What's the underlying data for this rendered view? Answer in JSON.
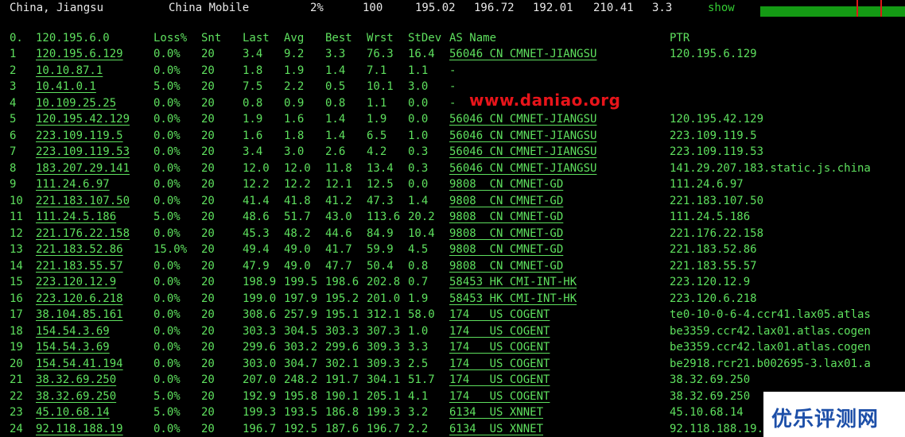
{
  "header": {
    "location": "China, Jiangsu",
    "isp": "China Mobile",
    "loss": "2%",
    "sent": "100",
    "last": "195.02",
    "avg": "196.72",
    "best": "192.01",
    "worst": "210.41",
    "stdev": "3.3",
    "show_link": "show",
    "bar_color": "#149a14",
    "marker_color": "#e01818"
  },
  "table": {
    "columns": {
      "idx": "0.",
      "host": "120.195.6.0",
      "loss": "Loss%",
      "snt": "Snt",
      "last": "Last",
      "avg": "Avg",
      "best": "Best",
      "wrst": "Wrst",
      "stdev": "StDev",
      "as": "AS Name",
      "ptr": "PTR"
    },
    "rows": [
      {
        "idx": "1",
        "host": "120.195.6.129",
        "loss": "0.0%",
        "snt": "20",
        "last": "3.4",
        "avg": "9.2",
        "best": "3.3",
        "wrst": "76.3",
        "stdev": "16.4",
        "as": "56046 CN CMNET-JIANGSU",
        "ptr": "120.195.6.129"
      },
      {
        "idx": "2",
        "host": "10.10.87.1",
        "loss": "0.0%",
        "snt": "20",
        "last": "1.8",
        "avg": "1.9",
        "best": "1.4",
        "wrst": "7.1",
        "stdev": "1.1",
        "as": "-",
        "ptr": ""
      },
      {
        "idx": "3",
        "host": "10.41.0.1",
        "loss": "5.0%",
        "snt": "20",
        "last": "7.5",
        "avg": "2.2",
        "best": "0.5",
        "wrst": "10.1",
        "stdev": "3.0",
        "as": "-",
        "ptr": ""
      },
      {
        "idx": "4",
        "host": "10.109.25.25",
        "loss": "0.0%",
        "snt": "20",
        "last": "0.8",
        "avg": "0.9",
        "best": "0.8",
        "wrst": "1.1",
        "stdev": "0.0",
        "as": "-",
        "ptr": ""
      },
      {
        "idx": "5",
        "host": "120.195.42.129",
        "loss": "0.0%",
        "snt": "20",
        "last": "1.9",
        "avg": "1.6",
        "best": "1.4",
        "wrst": "1.9",
        "stdev": "0.0",
        "as": "56046 CN CMNET-JIANGSU",
        "ptr": "120.195.42.129"
      },
      {
        "idx": "6",
        "host": "223.109.119.5",
        "loss": "0.0%",
        "snt": "20",
        "last": "1.6",
        "avg": "1.8",
        "best": "1.4",
        "wrst": "6.5",
        "stdev": "1.0",
        "as": "56046 CN CMNET-JIANGSU",
        "ptr": "223.109.119.5"
      },
      {
        "idx": "7",
        "host": "223.109.119.53",
        "loss": "0.0%",
        "snt": "20",
        "last": "3.4",
        "avg": "3.0",
        "best": "2.6",
        "wrst": "4.2",
        "stdev": "0.3",
        "as": "56046 CN CMNET-JIANGSU",
        "ptr": "223.109.119.53"
      },
      {
        "idx": "8",
        "host": "183.207.29.141",
        "loss": "0.0%",
        "snt": "20",
        "last": "12.0",
        "avg": "12.0",
        "best": "11.8",
        "wrst": "13.4",
        "stdev": "0.3",
        "as": "56046 CN CMNET-JIANGSU",
        "ptr": "141.29.207.183.static.js.china"
      },
      {
        "idx": "9",
        "host": "111.24.6.97",
        "loss": "0.0%",
        "snt": "20",
        "last": "12.2",
        "avg": "12.2",
        "best": "12.1",
        "wrst": "12.5",
        "stdev": "0.0",
        "as": "9808  CN CMNET-GD",
        "ptr": "111.24.6.97"
      },
      {
        "idx": "10",
        "host": "221.183.107.50",
        "loss": "0.0%",
        "snt": "20",
        "last": "41.4",
        "avg": "41.8",
        "best": "41.2",
        "wrst": "47.3",
        "stdev": "1.4",
        "as": "9808  CN CMNET-GD",
        "ptr": "221.183.107.50"
      },
      {
        "idx": "11",
        "host": "111.24.5.186",
        "loss": "5.0%",
        "snt": "20",
        "last": "48.6",
        "avg": "51.7",
        "best": "43.0",
        "wrst": "113.6",
        "stdev": "20.2",
        "as": "9808  CN CMNET-GD",
        "ptr": "111.24.5.186"
      },
      {
        "idx": "12",
        "host": "221.176.22.158",
        "loss": "0.0%",
        "snt": "20",
        "last": "45.3",
        "avg": "48.2",
        "best": "44.6",
        "wrst": "84.9",
        "stdev": "10.4",
        "as": "9808  CN CMNET-GD",
        "ptr": "221.176.22.158"
      },
      {
        "idx": "13",
        "host": "221.183.52.86",
        "loss": "15.0%",
        "snt": "20",
        "last": "49.4",
        "avg": "49.0",
        "best": "41.7",
        "wrst": "59.9",
        "stdev": "4.5",
        "as": "9808  CN CMNET-GD",
        "ptr": "221.183.52.86"
      },
      {
        "idx": "14",
        "host": "221.183.55.57",
        "loss": "0.0%",
        "snt": "20",
        "last": "47.9",
        "avg": "49.0",
        "best": "47.7",
        "wrst": "50.4",
        "stdev": "0.8",
        "as": "9808  CN CMNET-GD",
        "ptr": "221.183.55.57"
      },
      {
        "idx": "15",
        "host": "223.120.12.9",
        "loss": "0.0%",
        "snt": "20",
        "last": "198.9",
        "avg": "199.5",
        "best": "198.6",
        "wrst": "202.8",
        "stdev": "0.7",
        "as": "58453 HK CMI-INT-HK",
        "ptr": "223.120.12.9"
      },
      {
        "idx": "16",
        "host": "223.120.6.218",
        "loss": "0.0%",
        "snt": "20",
        "last": "199.0",
        "avg": "197.9",
        "best": "195.2",
        "wrst": "201.0",
        "stdev": "1.9",
        "as": "58453 HK CMI-INT-HK",
        "ptr": "223.120.6.218"
      },
      {
        "idx": "17",
        "host": "38.104.85.161",
        "loss": "0.0%",
        "snt": "20",
        "last": "308.6",
        "avg": "257.9",
        "best": "195.1",
        "wrst": "312.1",
        "stdev": "58.0",
        "as": "174   US COGENT",
        "ptr": "te0-10-0-6-4.ccr41.lax05.atlas"
      },
      {
        "idx": "18",
        "host": "154.54.3.69",
        "loss": "0.0%",
        "snt": "20",
        "last": "303.3",
        "avg": "304.5",
        "best": "303.3",
        "wrst": "307.3",
        "stdev": "1.0",
        "as": "174   US COGENT",
        "ptr": "be3359.ccr42.lax01.atlas.cogen"
      },
      {
        "idx": "19",
        "host": "154.54.3.69",
        "loss": "0.0%",
        "snt": "20",
        "last": "299.6",
        "avg": "303.2",
        "best": "299.6",
        "wrst": "309.3",
        "stdev": "3.3",
        "as": "174   US COGENT",
        "ptr": "be3359.ccr42.lax01.atlas.cogen"
      },
      {
        "idx": "20",
        "host": "154.54.41.194",
        "loss": "0.0%",
        "snt": "20",
        "last": "303.0",
        "avg": "304.7",
        "best": "302.1",
        "wrst": "309.3",
        "stdev": "2.5",
        "as": "174   US COGENT",
        "ptr": "be2918.rcr21.b002695-3.lax01.a"
      },
      {
        "idx": "21",
        "host": "38.32.69.250",
        "loss": "0.0%",
        "snt": "20",
        "last": "207.0",
        "avg": "248.2",
        "best": "191.7",
        "wrst": "304.1",
        "stdev": "51.7",
        "as": "174   US COGENT",
        "ptr": "38.32.69.250"
      },
      {
        "idx": "22",
        "host": "38.32.69.250",
        "loss": "5.0%",
        "snt": "20",
        "last": "192.9",
        "avg": "195.8",
        "best": "190.1",
        "wrst": "205.1",
        "stdev": "4.1",
        "as": "174   US COGENT",
        "ptr": "38.32.69.250"
      },
      {
        "idx": "23",
        "host": "45.10.68.14",
        "loss": "5.0%",
        "snt": "20",
        "last": "199.3",
        "avg": "193.5",
        "best": "186.8",
        "wrst": "199.3",
        "stdev": "3.2",
        "as": "6134  US XNNET",
        "ptr": "45.10.68.14"
      },
      {
        "idx": "24",
        "host": "92.118.188.19",
        "loss": "0.0%",
        "snt": "20",
        "last": "196.7",
        "avg": "192.5",
        "best": "187.6",
        "wrst": "196.7",
        "stdev": "2.2",
        "as": "6134  US XNNET",
        "ptr": "92.118.188.19.s"
      }
    ]
  },
  "watermark": "www.daniao.org",
  "logo_text": "优乐评测网",
  "colors": {
    "text_green": "#5ee05e",
    "link_green": "#33cc33",
    "background": "#000000",
    "watermark_red": "#e8141a"
  }
}
